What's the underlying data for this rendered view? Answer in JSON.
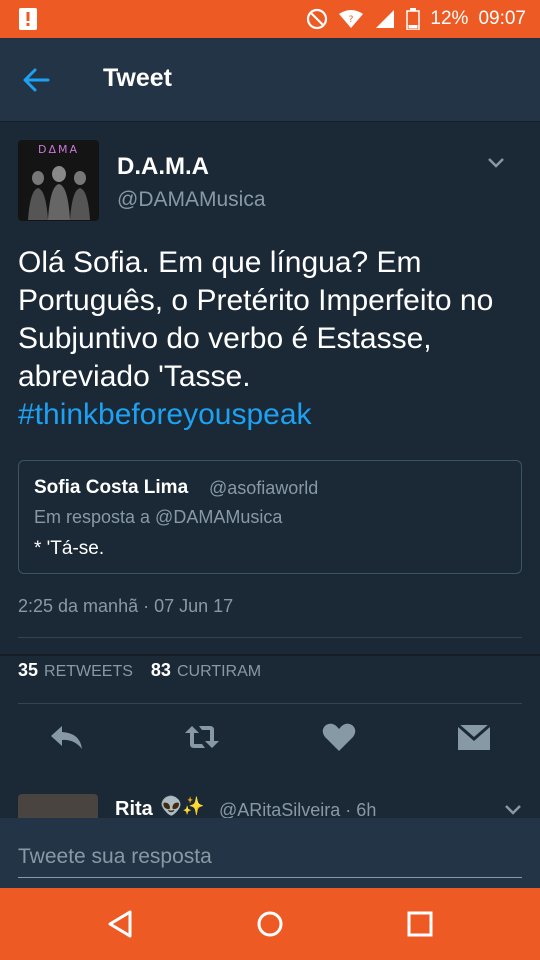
{
  "status_bar": {
    "battery": "12%",
    "time": "09:07"
  },
  "header": {
    "title": "Tweet"
  },
  "tweet": {
    "avatar_logo": "DΔMA",
    "name": "D.A.M.A",
    "handle": "@DAMAMusica",
    "text": "Olá Sofia. Em que língua? Em Português, o Pretérito Imperfeito no Subjuntivo do verbo é Estasse, abreviado 'Tasse.",
    "hashtag": "#thinkbeforeyouspeak",
    "quoted": {
      "name": "Sofia Costa Lima",
      "handle": "@asofiaworld",
      "reply_to": "Em resposta a @DAMAMusica",
      "text": "* 'Tá-se."
    },
    "timestamp": "2:25 da manhã · 07 Jun 17",
    "retweets_count": "35",
    "retweets_label": "RETWEETS",
    "likes_count": "83",
    "likes_label": "CURTIRAM"
  },
  "reply_preview": {
    "name": "Rita",
    "emoji": "👽✨",
    "handle": "@ARitaSilveira · 6h"
  },
  "composer": {
    "placeholder": "Tweete sua resposta"
  },
  "colors": {
    "accent": "#1da1f2",
    "background": "#1b2836",
    "system_bar": "#ee5a24"
  }
}
